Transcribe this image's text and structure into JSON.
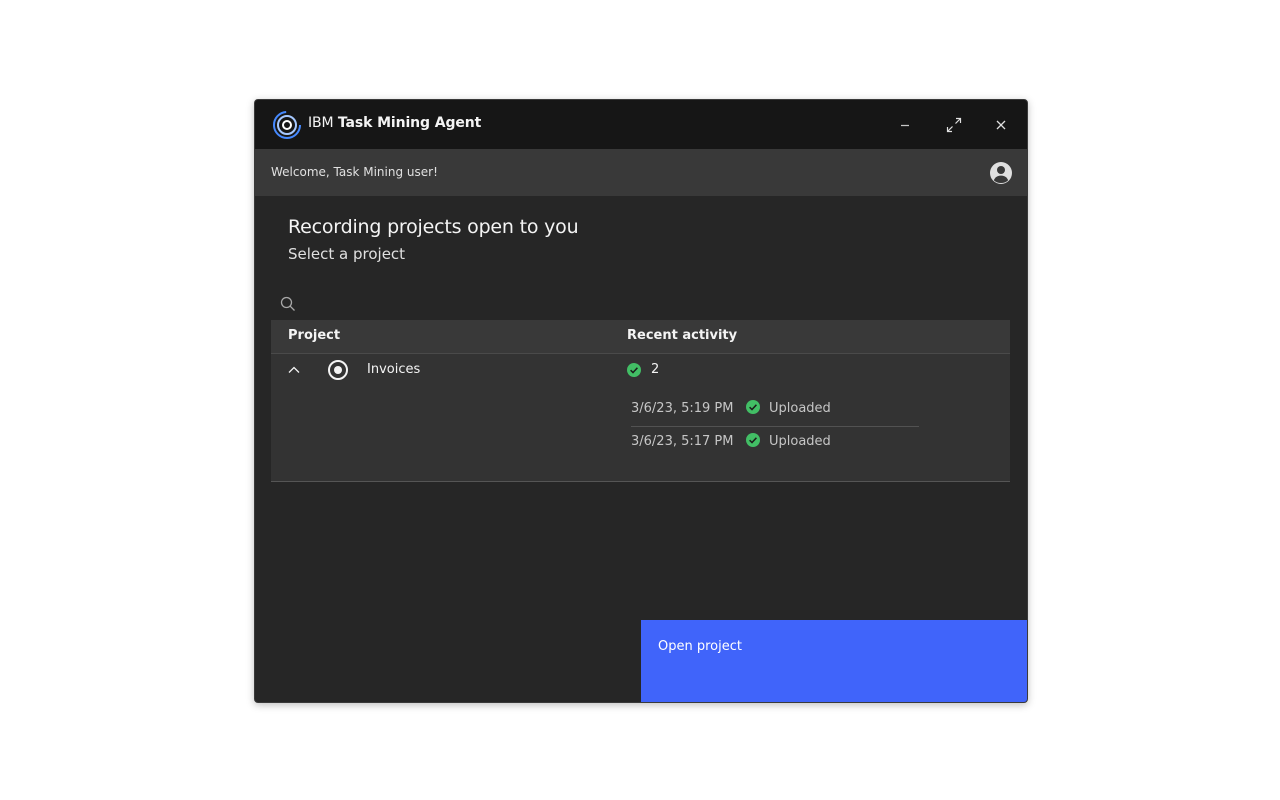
{
  "window": {
    "title_brand": "IBM",
    "title_name": "Task Mining Agent",
    "controls": {
      "minimize_icon": "minimize-icon",
      "maximize_icon": "maximize-icon",
      "close_icon": "close-icon"
    }
  },
  "header": {
    "welcome_text": "Welcome, Task Mining user!",
    "avatar_icon": "user-avatar-icon"
  },
  "main": {
    "title": "Recording projects open to you",
    "subtitle": "Select a project",
    "search": {
      "placeholder": "",
      "value": "",
      "icon": "search-icon"
    }
  },
  "table": {
    "columns": [
      "Project",
      "Recent activity"
    ],
    "rows": [
      {
        "name": "Invoices",
        "selected": true,
        "expanded": true,
        "activity_count": "2",
        "activity": [
          {
            "time": "3/6/23, 5:19 PM",
            "status": "Uploaded"
          },
          {
            "time": "3/6/23, 5:17 PM",
            "status": "Uploaded"
          }
        ]
      }
    ]
  },
  "footer": {
    "open_button_label": "Open project"
  },
  "colors": {
    "titlebar": "#161616",
    "header": "#393939",
    "background": "#262626",
    "primary_button": "#4064fa",
    "success": "#42be65"
  }
}
